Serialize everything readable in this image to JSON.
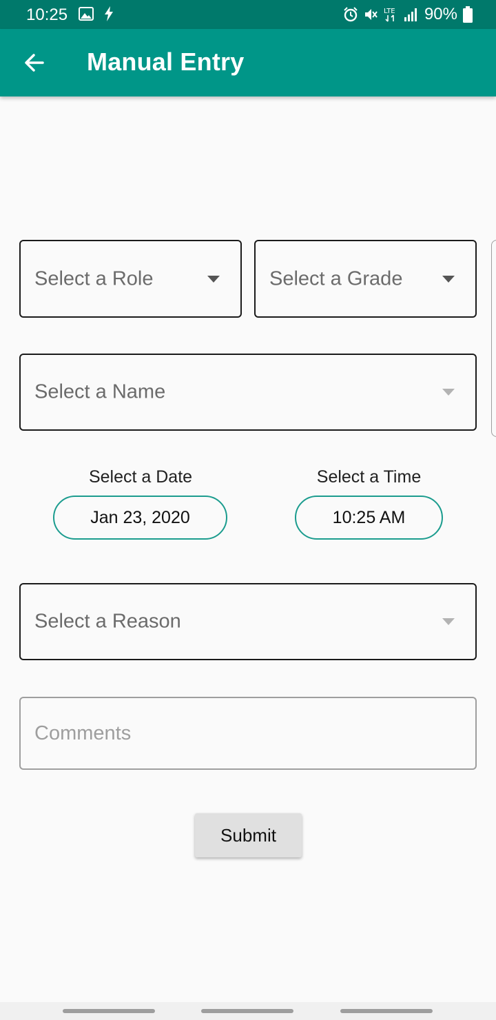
{
  "status_bar": {
    "time": "10:25",
    "battery": "90%",
    "network_type": "LTE",
    "icons": [
      "image-icon",
      "flash-icon",
      "alarm-icon",
      "mute-icon",
      "signal-icon",
      "battery-icon"
    ]
  },
  "app_bar": {
    "title": "Manual Entry",
    "back_icon": "arrow-left-icon",
    "color": "#009688"
  },
  "form": {
    "role": {
      "placeholder": "Select a Role"
    },
    "grade": {
      "placeholder": "Select a Grade"
    },
    "name": {
      "placeholder": "Select a Name"
    },
    "date": {
      "label": "Select a Date",
      "value": "Jan 23, 2020"
    },
    "time": {
      "label": "Select a Time",
      "value": "10:25 AM"
    },
    "reason": {
      "placeholder": "Select a Reason"
    },
    "comments": {
      "placeholder": "Comments",
      "value": ""
    },
    "submit_label": "Submit"
  },
  "colors": {
    "status_bar": "#00796b",
    "accent": "#1b9c8e",
    "background": "#fafafa"
  }
}
